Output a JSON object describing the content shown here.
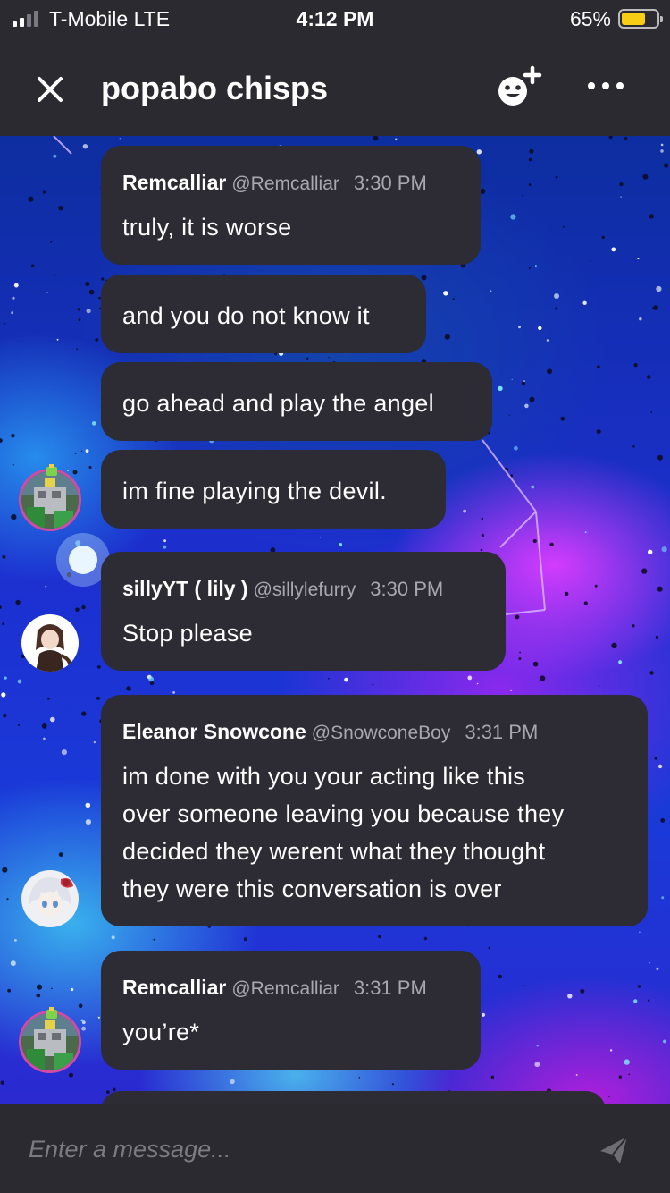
{
  "status_bar": {
    "carrier": "T-Mobile  LTE",
    "time": "4:12 PM",
    "battery_percent": "65%",
    "battery_level": 0.65,
    "signal_bars": 2
  },
  "header": {
    "title": "popabo chisps",
    "close_icon": "close-icon",
    "invite_icon": "add-member-icon",
    "more_icon": "more-options-icon"
  },
  "messages": [
    {
      "author": "Remcalliar",
      "handle": "@Remcalliar",
      "time": "3:30 PM",
      "text": "truly, it is worse"
    },
    {
      "text": "and you do not know it"
    },
    {
      "text": "go ahead and play the angel"
    },
    {
      "text": "im fine playing the devil."
    },
    {
      "author": "sillyYT ( lily )",
      "handle": "@sillylefurry",
      "time": "3:30 PM",
      "text": "Stop please"
    },
    {
      "author": "Eleanor Snowcone",
      "handle": "@SnowconeBoy",
      "time": "3:31 PM",
      "text": "im done with you your acting like this\nover someone leaving you because they\ndecided they werent what they thought\nthey were this conversation is over"
    },
    {
      "author": "Remcalliar",
      "handle": "@Remcalliar",
      "time": "3:31 PM",
      "text": "you’re*"
    }
  ],
  "composer": {
    "placeholder": "Enter a message...",
    "send_icon": "send-icon"
  },
  "colors": {
    "bar_bg": "#2c2a31",
    "bubble_bg": "#2d2b33",
    "avatar_ring": "#d24aa6",
    "battery_fill": "#f7cd15"
  }
}
